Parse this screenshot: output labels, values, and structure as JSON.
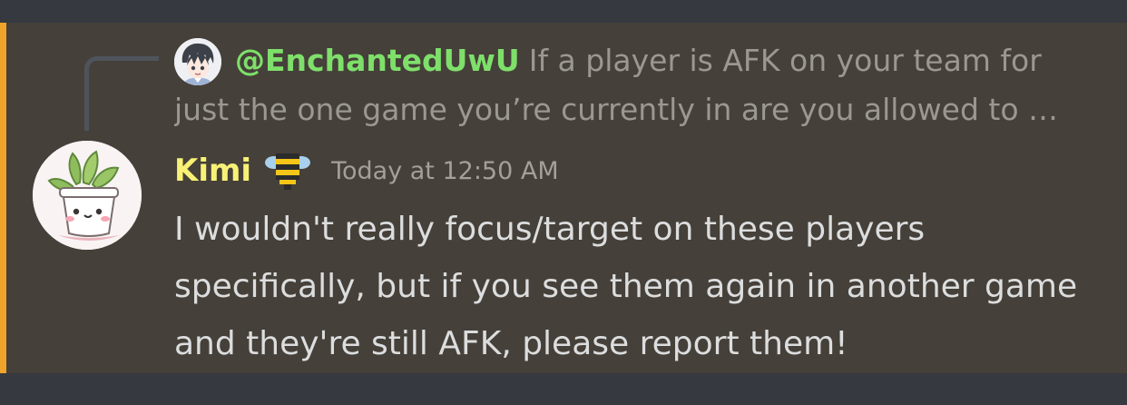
{
  "reply": {
    "author": "@EnchantedUwU",
    "preview": "If a player is AFK on your team for just the one game you’re currently in are you allowed to …"
  },
  "message": {
    "author": "Kimi",
    "timestamp": "Today at 12:50 AM",
    "content": "I wouldn't really focus/target on these players specifically, but if you see them again in another game and they're still AFK, please report them!",
    "role_icon": "bee-icon"
  },
  "colors": {
    "background": "#36393f",
    "message_highlight": "#454039",
    "mention_bar": "#f0a52a",
    "reply_author": "#7ee06a",
    "author": "#f8f176",
    "text": "#dcddde",
    "muted_text": "#9b9890"
  }
}
